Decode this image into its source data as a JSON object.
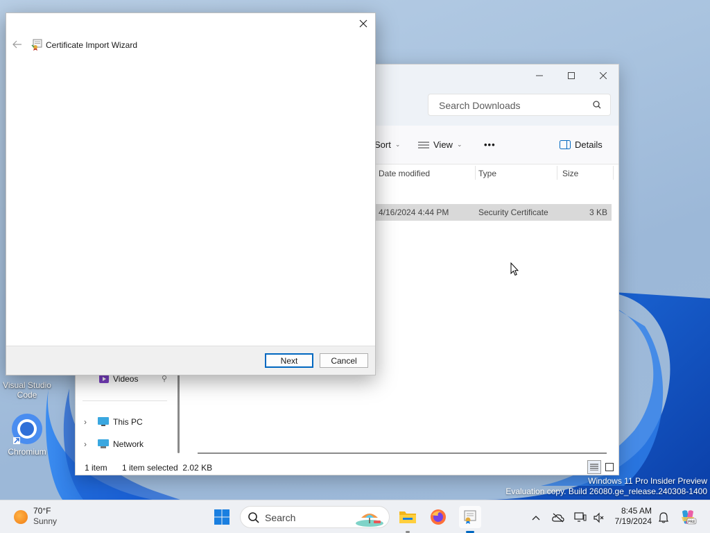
{
  "desktop": {
    "icons": [
      {
        "label": "Visual Studio Code"
      },
      {
        "label": "Chromium"
      }
    ]
  },
  "explorer": {
    "search_placeholder": "Search Downloads",
    "toolbar": {
      "sort_label": "Sort",
      "view_label": "View",
      "more_label": "•••",
      "details_label": "Details"
    },
    "columns": {
      "date_modified": "Date modified",
      "type": "Type",
      "size": "Size"
    },
    "rows": [
      {
        "date_modified": "4/16/2024 4:44 PM",
        "type": "Security Certificate",
        "size": "3 KB"
      }
    ],
    "nav": {
      "videos": "Videos",
      "this_pc": "This PC",
      "network": "Network"
    },
    "status": {
      "item_count": "1 item",
      "selection": "1 item selected  2.02 KB"
    }
  },
  "wizard": {
    "title": "Certificate Import Wizard",
    "next_label": "Next",
    "cancel_label": "Cancel"
  },
  "watermark": {
    "line1": "Windows 11 Pro Insider Preview",
    "line2": "Evaluation copy. Build 26080.ge_release.240308-1400"
  },
  "taskbar": {
    "weather_temp": "70°F",
    "weather_cond": "Sunny",
    "search_placeholder": "Search",
    "time": "8:45 AM",
    "date": "7/19/2024"
  },
  "colors": {
    "accent": "#0067c0",
    "selected_row": "#d9d9d9",
    "taskbar_bg": "#eef0f4"
  }
}
